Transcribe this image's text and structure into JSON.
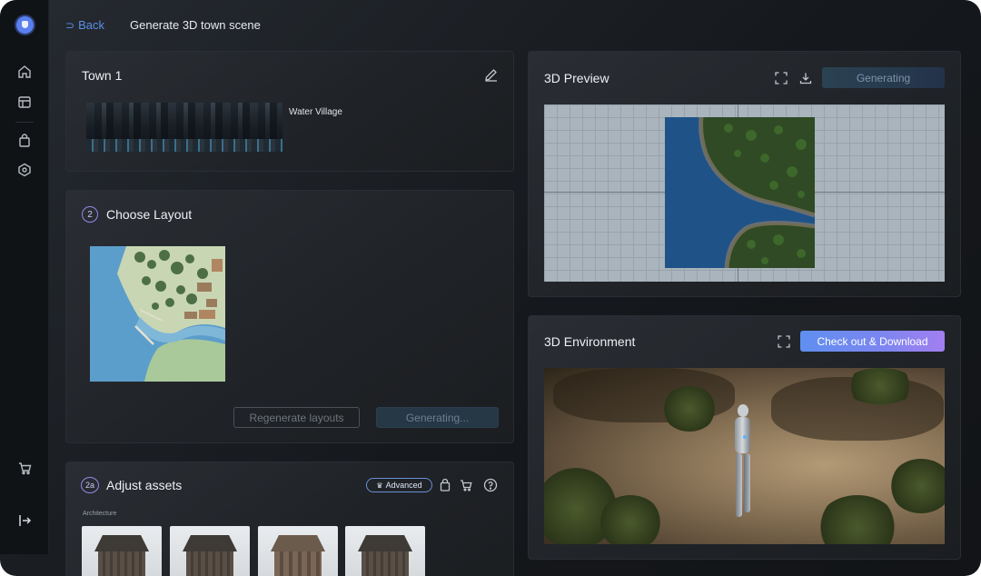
{
  "topbar": {
    "back_label": "Back",
    "page_title": "Generate 3D town scene"
  },
  "sidebar": {
    "items": [
      {
        "icon": "home-icon"
      },
      {
        "icon": "storefront-icon"
      },
      {
        "icon": "shopping-bag-icon"
      },
      {
        "icon": "cube-network-icon"
      }
    ],
    "bottom": [
      {
        "icon": "cart-icon"
      },
      {
        "icon": "logout-icon"
      }
    ]
  },
  "town_card": {
    "title": "Town 1",
    "preset_label": "Water Village"
  },
  "layout_card": {
    "step": "2",
    "title": "Choose Layout",
    "regenerate_label": "Regenerate layouts",
    "generating_label": "Generating..."
  },
  "assets_card": {
    "step": "2a",
    "title": "Adjust assets",
    "advanced_label": "Advanced",
    "section_label": "Architecture",
    "thumbnails": 4
  },
  "preview_card": {
    "title": "3D Preview",
    "status_button": "Generating"
  },
  "environment_card": {
    "title": "3D Environment",
    "checkout_label": "Check out & Download"
  },
  "colors": {
    "accent": "#5b8ee8",
    "badge_purple": "#9c84e8",
    "checkout_gradient_start": "#5f8ff0",
    "checkout_gradient_end": "#a27ff0"
  }
}
